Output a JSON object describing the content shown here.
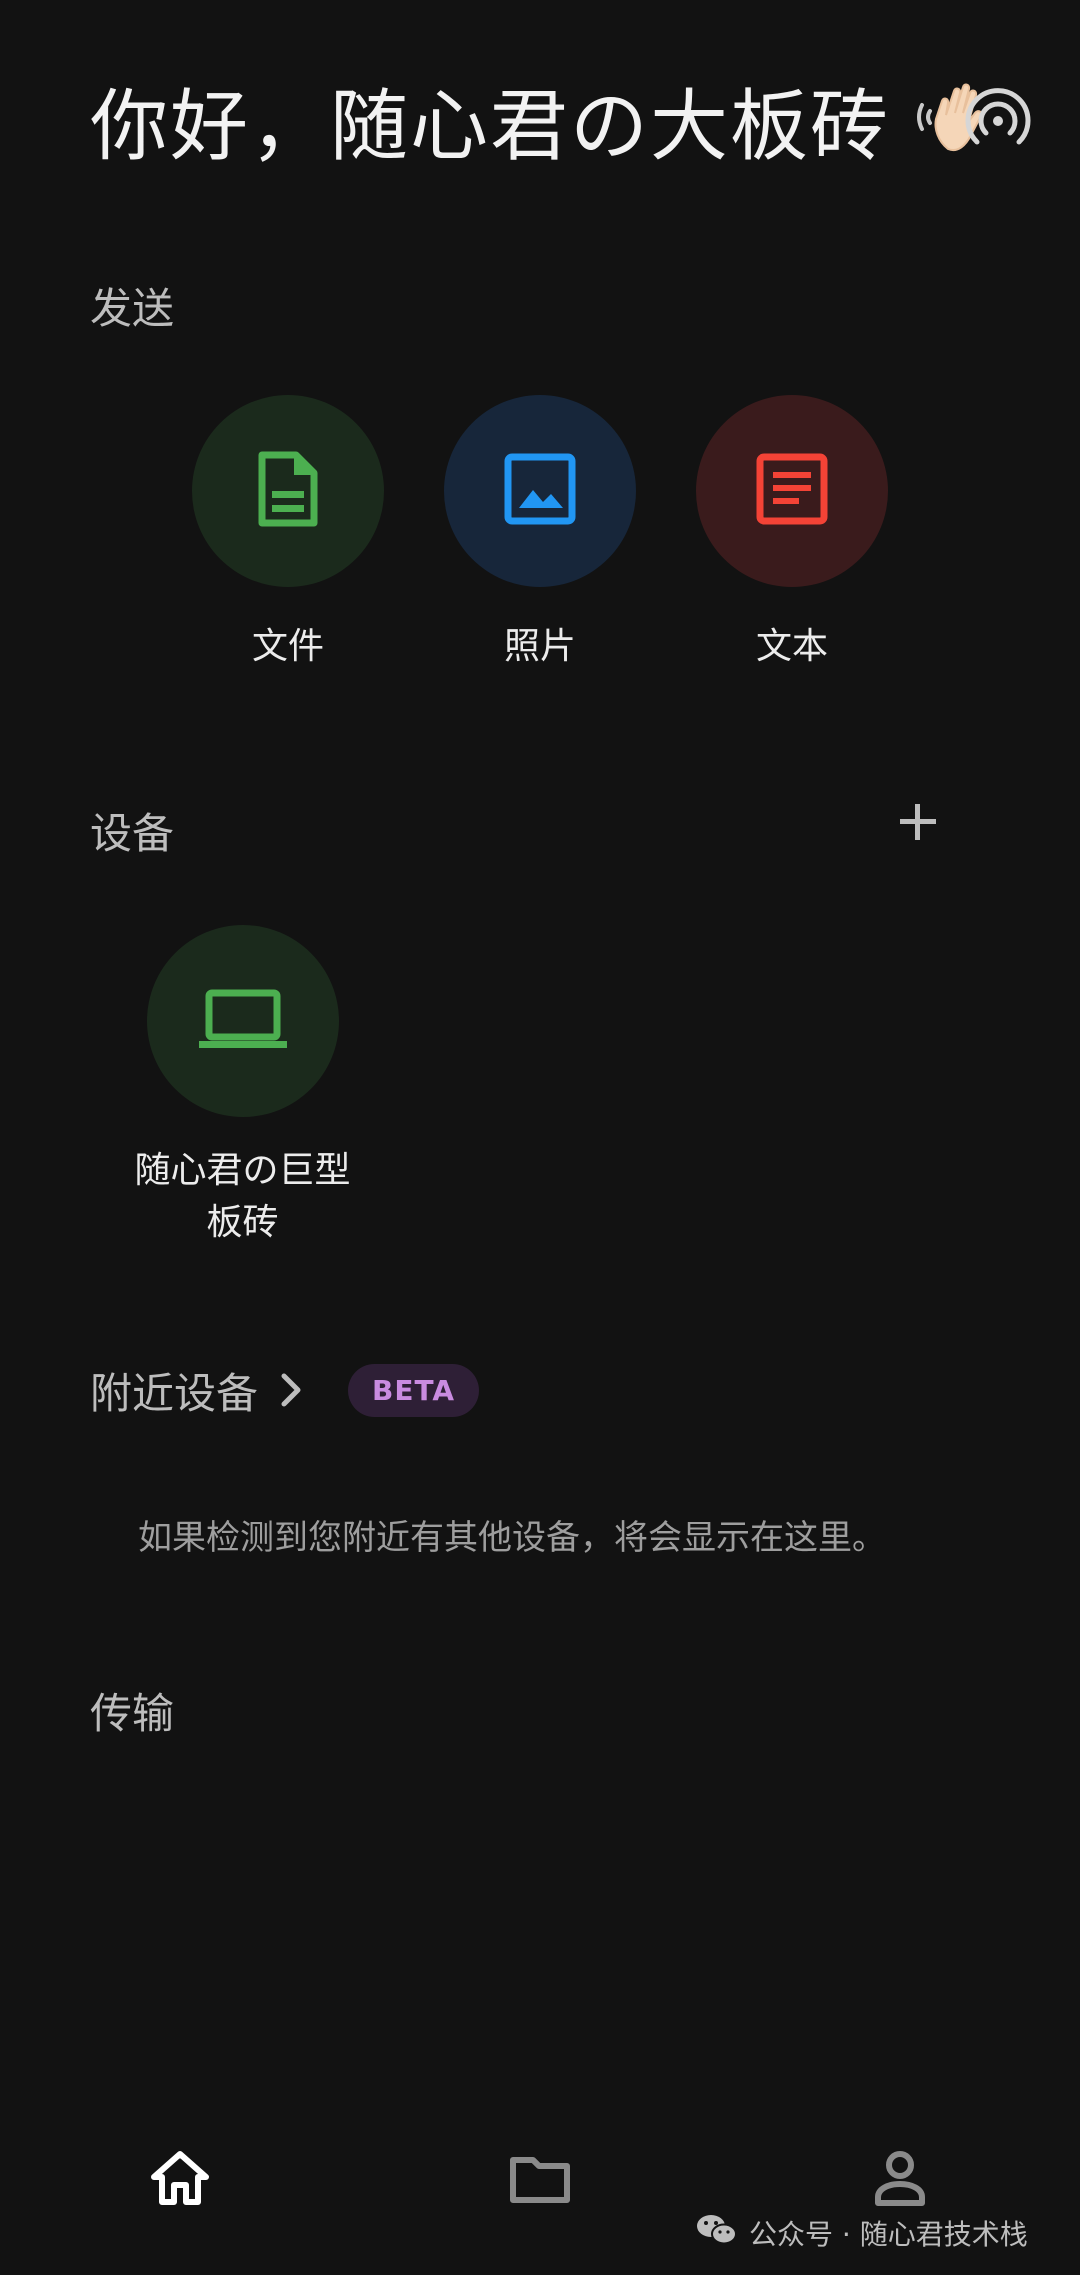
{
  "greeting": {
    "text": "你好，随心君の大板砖",
    "emoji_icon": "waving-hand-icon"
  },
  "send": {
    "title": "发送",
    "items": [
      {
        "label": "文件",
        "icon": "file-icon",
        "color": "#4caf50"
      },
      {
        "label": "照片",
        "icon": "image-icon",
        "color": "#2196f3"
      },
      {
        "label": "文本",
        "icon": "text-icon",
        "color": "#f44336"
      }
    ]
  },
  "devices": {
    "title": "设备",
    "add_icon": "plus-icon",
    "items": [
      {
        "label_line1": "随心君の巨型",
        "label_line2": "板砖",
        "icon": "laptop-icon",
        "color": "#4caf50"
      }
    ]
  },
  "nearby": {
    "title": "附近设备",
    "badge": "BETA",
    "hint": "如果检测到您附近有其他设备，将会显示在这里。"
  },
  "transfer": {
    "title": "传输"
  },
  "bottom_nav": {
    "items": [
      {
        "icon": "home-icon",
        "active": true
      },
      {
        "icon": "folder-icon",
        "active": false
      },
      {
        "icon": "person-icon",
        "active": false
      }
    ]
  },
  "watermark": {
    "text": "公众号 · 随心君技术栈",
    "icon": "wechat-icon"
  },
  "colors": {
    "background": "#121212",
    "green": "#4caf50",
    "blue": "#2196f3",
    "red": "#f44336",
    "beta_bg": "#2e1f36",
    "beta_text": "#c98be0"
  }
}
